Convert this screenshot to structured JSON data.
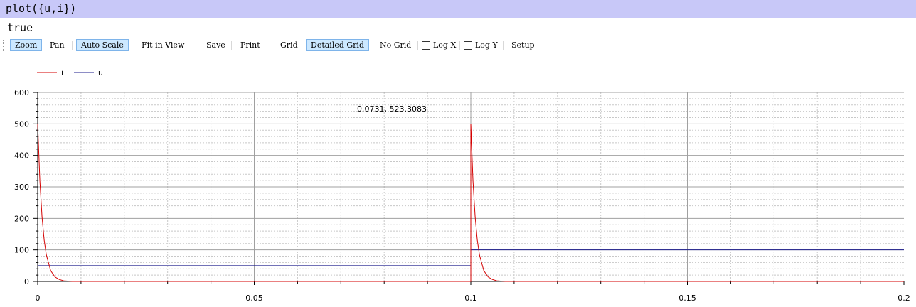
{
  "command": {
    "text": "plot({u,i})"
  },
  "result": {
    "text": "true"
  },
  "toolbar": {
    "zoom": "Zoom",
    "pan": "Pan",
    "auto_scale": "Auto Scale",
    "fit_in_view": "Fit in View",
    "save": "Save",
    "print": "Print",
    "grid": "Grid",
    "detailed_grid": "Detailed Grid",
    "no_grid": "No Grid",
    "log_x": "Log X",
    "log_y": "Log Y",
    "setup": "Setup",
    "active": [
      "Zoom",
      "Auto Scale",
      "Detailed Grid"
    ],
    "log_x_checked": false,
    "log_y_checked": false
  },
  "colors": {
    "i": "#d40000",
    "u": "#1e1e8c",
    "active_button": "#cce8ff"
  },
  "coordinate_readout": "0.0731, 523.3083",
  "chart_data": {
    "type": "line",
    "xlim": [
      0,
      0.2
    ],
    "ylim": [
      0,
      600
    ],
    "x_ticks": [
      "0",
      "0.05",
      "0.1",
      "0.15",
      "0.2"
    ],
    "y_ticks": [
      "0",
      "100",
      "200",
      "300",
      "400",
      "500",
      "600"
    ],
    "grid": "detailed",
    "legend_position": "top-left",
    "series": [
      {
        "name": "i",
        "color": "#d40000",
        "points": [
          [
            0,
            500
          ],
          [
            0.0005,
            320
          ],
          [
            0.001,
            205
          ],
          [
            0.0015,
            131
          ],
          [
            0.002,
            84
          ],
          [
            0.003,
            34
          ],
          [
            0.004,
            14
          ],
          [
            0.005,
            6
          ],
          [
            0.006,
            2
          ],
          [
            0.008,
            0
          ],
          [
            0.1,
            0
          ],
          [
            0.1,
            500
          ],
          [
            0.1005,
            320
          ],
          [
            0.101,
            205
          ],
          [
            0.1015,
            131
          ],
          [
            0.102,
            84
          ],
          [
            0.103,
            34
          ],
          [
            0.104,
            14
          ],
          [
            0.105,
            6
          ],
          [
            0.106,
            2
          ],
          [
            0.108,
            0
          ],
          [
            0.2,
            0
          ]
        ]
      },
      {
        "name": "u",
        "color": "#1e1e8c",
        "points": [
          [
            0,
            50
          ],
          [
            0.1,
            50
          ],
          [
            0.1,
            100
          ],
          [
            0.2,
            100
          ]
        ]
      }
    ]
  }
}
